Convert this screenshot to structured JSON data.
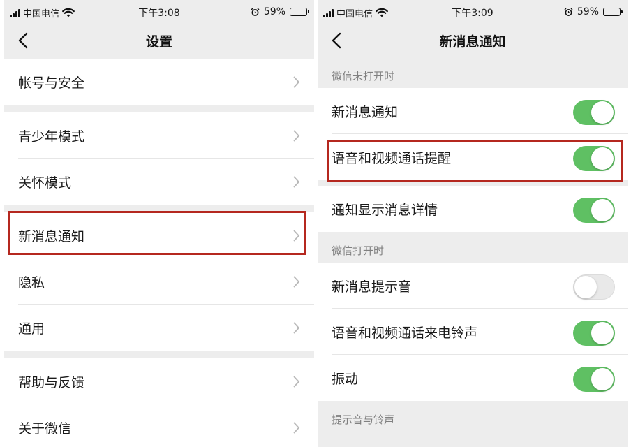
{
  "colors": {
    "toggle_on": "#5fc063",
    "highlight": "#b5281f"
  },
  "left": {
    "status": {
      "carrier": "中国电信",
      "time": "下午3:08",
      "battery": "59%",
      "battery_level": 0.59
    },
    "title": "设置",
    "rows": [
      "帐号与安全",
      "青少年模式",
      "关怀模式",
      "新消息通知",
      "隐私",
      "通用",
      "帮助与反馈",
      "关于微信"
    ],
    "highlighted_item": "新消息通知"
  },
  "right": {
    "status": {
      "carrier": "中国电信",
      "time": "下午3:09",
      "battery": "59%",
      "battery_level": 0.59
    },
    "title": "新消息通知",
    "sections": [
      {
        "header": "微信未打开时",
        "rows": [
          {
            "label": "新消息通知",
            "on": true
          },
          {
            "label": "语音和视频通话提醒",
            "on": true
          },
          {
            "label": "通知显示消息详情",
            "on": true
          }
        ]
      },
      {
        "header": "微信打开时",
        "rows": [
          {
            "label": "新消息提示音",
            "on": false
          },
          {
            "label": "语音和视频通话来电铃声",
            "on": true
          },
          {
            "label": "振动",
            "on": true
          }
        ]
      },
      {
        "header": "提示音与铃声",
        "rows": []
      }
    ],
    "highlighted_item": "语音和视频通话提醒"
  }
}
